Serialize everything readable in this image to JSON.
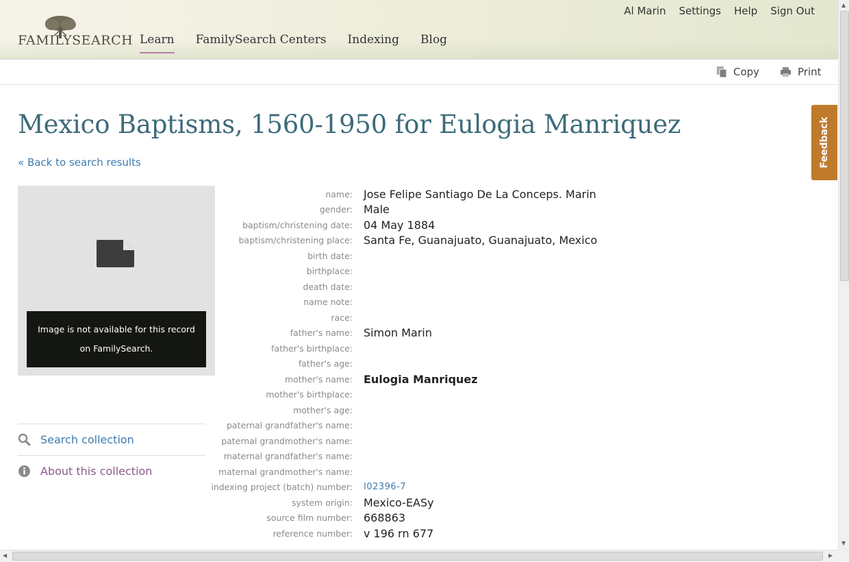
{
  "header": {
    "logo_text": "FAMILYSEARCH",
    "nav": [
      "Learn",
      "FamilySearch Centers",
      "Indexing",
      "Blog"
    ],
    "active_nav": "Learn",
    "user_nav": [
      "Al Marin",
      "Settings",
      "Help",
      "Sign Out"
    ]
  },
  "toolbar": {
    "copy_label": "Copy",
    "print_label": "Print"
  },
  "page": {
    "title": "Mexico Baptisms, 1560-1950 for Eulogia Manriquez",
    "back_link": "« Back to search results",
    "image_message_line1": "Image is not available for this record",
    "image_message_line2": "on FamilySearch.",
    "feedback_label": "Feedback"
  },
  "sidebar": {
    "search_collection": "Search collection",
    "about_collection": "About this collection"
  },
  "record": [
    {
      "label": "name:",
      "value": "Jose Felipe Santiago De La Conceps. Marin"
    },
    {
      "label": "gender:",
      "value": "Male"
    },
    {
      "label": "baptism/christening date:",
      "value": "04 May 1884"
    },
    {
      "label": "baptism/christening place:",
      "value": "Santa Fe, Guanajuato, Guanajuato, Mexico"
    },
    {
      "label": "birth date:",
      "value": ""
    },
    {
      "label": "birthplace:",
      "value": ""
    },
    {
      "label": "death date:",
      "value": ""
    },
    {
      "label": "name note:",
      "value": ""
    },
    {
      "label": "race:",
      "value": ""
    },
    {
      "label": "father's name:",
      "value": "Simon Marin"
    },
    {
      "label": "father's birthplace:",
      "value": ""
    },
    {
      "label": "father's age:",
      "value": ""
    },
    {
      "label": "mother's name:",
      "value": "Eulogia Manriquez",
      "style": "bold"
    },
    {
      "label": "mother's birthplace:",
      "value": ""
    },
    {
      "label": "mother's age:",
      "value": ""
    },
    {
      "label": "paternal grandfather's name:",
      "value": ""
    },
    {
      "label": "paternal grandmother's name:",
      "value": ""
    },
    {
      "label": "maternal grandfather's name:",
      "value": ""
    },
    {
      "label": "maternal grandmother's name:",
      "value": ""
    },
    {
      "label": "indexing project (batch) number:",
      "value": "I02396-7",
      "style": "link"
    },
    {
      "label": "system origin:",
      "value": "Mexico-EASy"
    },
    {
      "label": "source film number:",
      "value": "668863"
    },
    {
      "label": "reference number:",
      "value": "v 196 rn 677"
    }
  ],
  "colors": {
    "title": "#3d6b7a",
    "link": "#3f7bb0",
    "feedback": "#c07a2c",
    "active_underline": "#b47ea4"
  }
}
